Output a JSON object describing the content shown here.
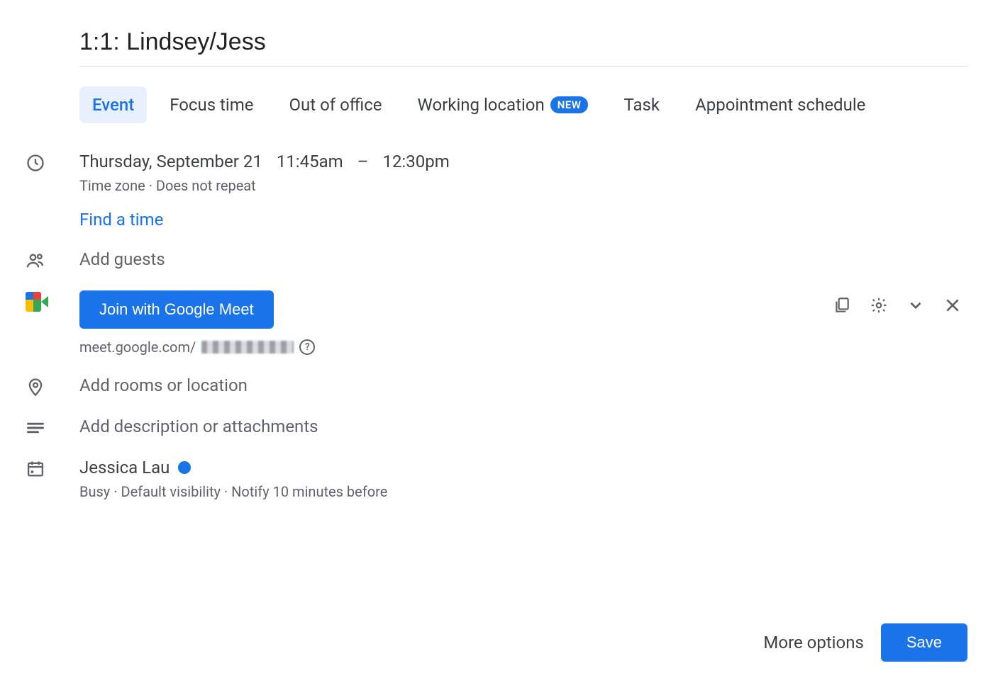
{
  "title": "1:1: Lindsey/Jess",
  "tabs": [
    {
      "label": "Event",
      "active": true
    },
    {
      "label": "Focus time"
    },
    {
      "label": "Out of office"
    },
    {
      "label": "Working location",
      "badge": "NEW"
    },
    {
      "label": "Task"
    },
    {
      "label": "Appointment schedule"
    }
  ],
  "datetime": {
    "date": "Thursday, September 21",
    "start": "11:45am",
    "dash": "–",
    "end": "12:30pm",
    "tz_label": "Time zone",
    "separator": " · ",
    "repeat": "Does not repeat",
    "find_a_time": "Find a time"
  },
  "guests": {
    "placeholder": "Add guests"
  },
  "meet": {
    "button": "Join with Google Meet",
    "link_prefix": "meet.google.com/",
    "help": "?"
  },
  "location": {
    "placeholder": "Add rooms or location"
  },
  "description": {
    "placeholder": "Add description or attachments"
  },
  "calendar": {
    "owner": "Jessica Lau",
    "status_color": "#1a73e8",
    "busy": "Busy",
    "sep": " · ",
    "visibility": "Default visibility",
    "notify": "Notify 10 minutes before"
  },
  "footer": {
    "more_options": "More options",
    "save": "Save"
  }
}
